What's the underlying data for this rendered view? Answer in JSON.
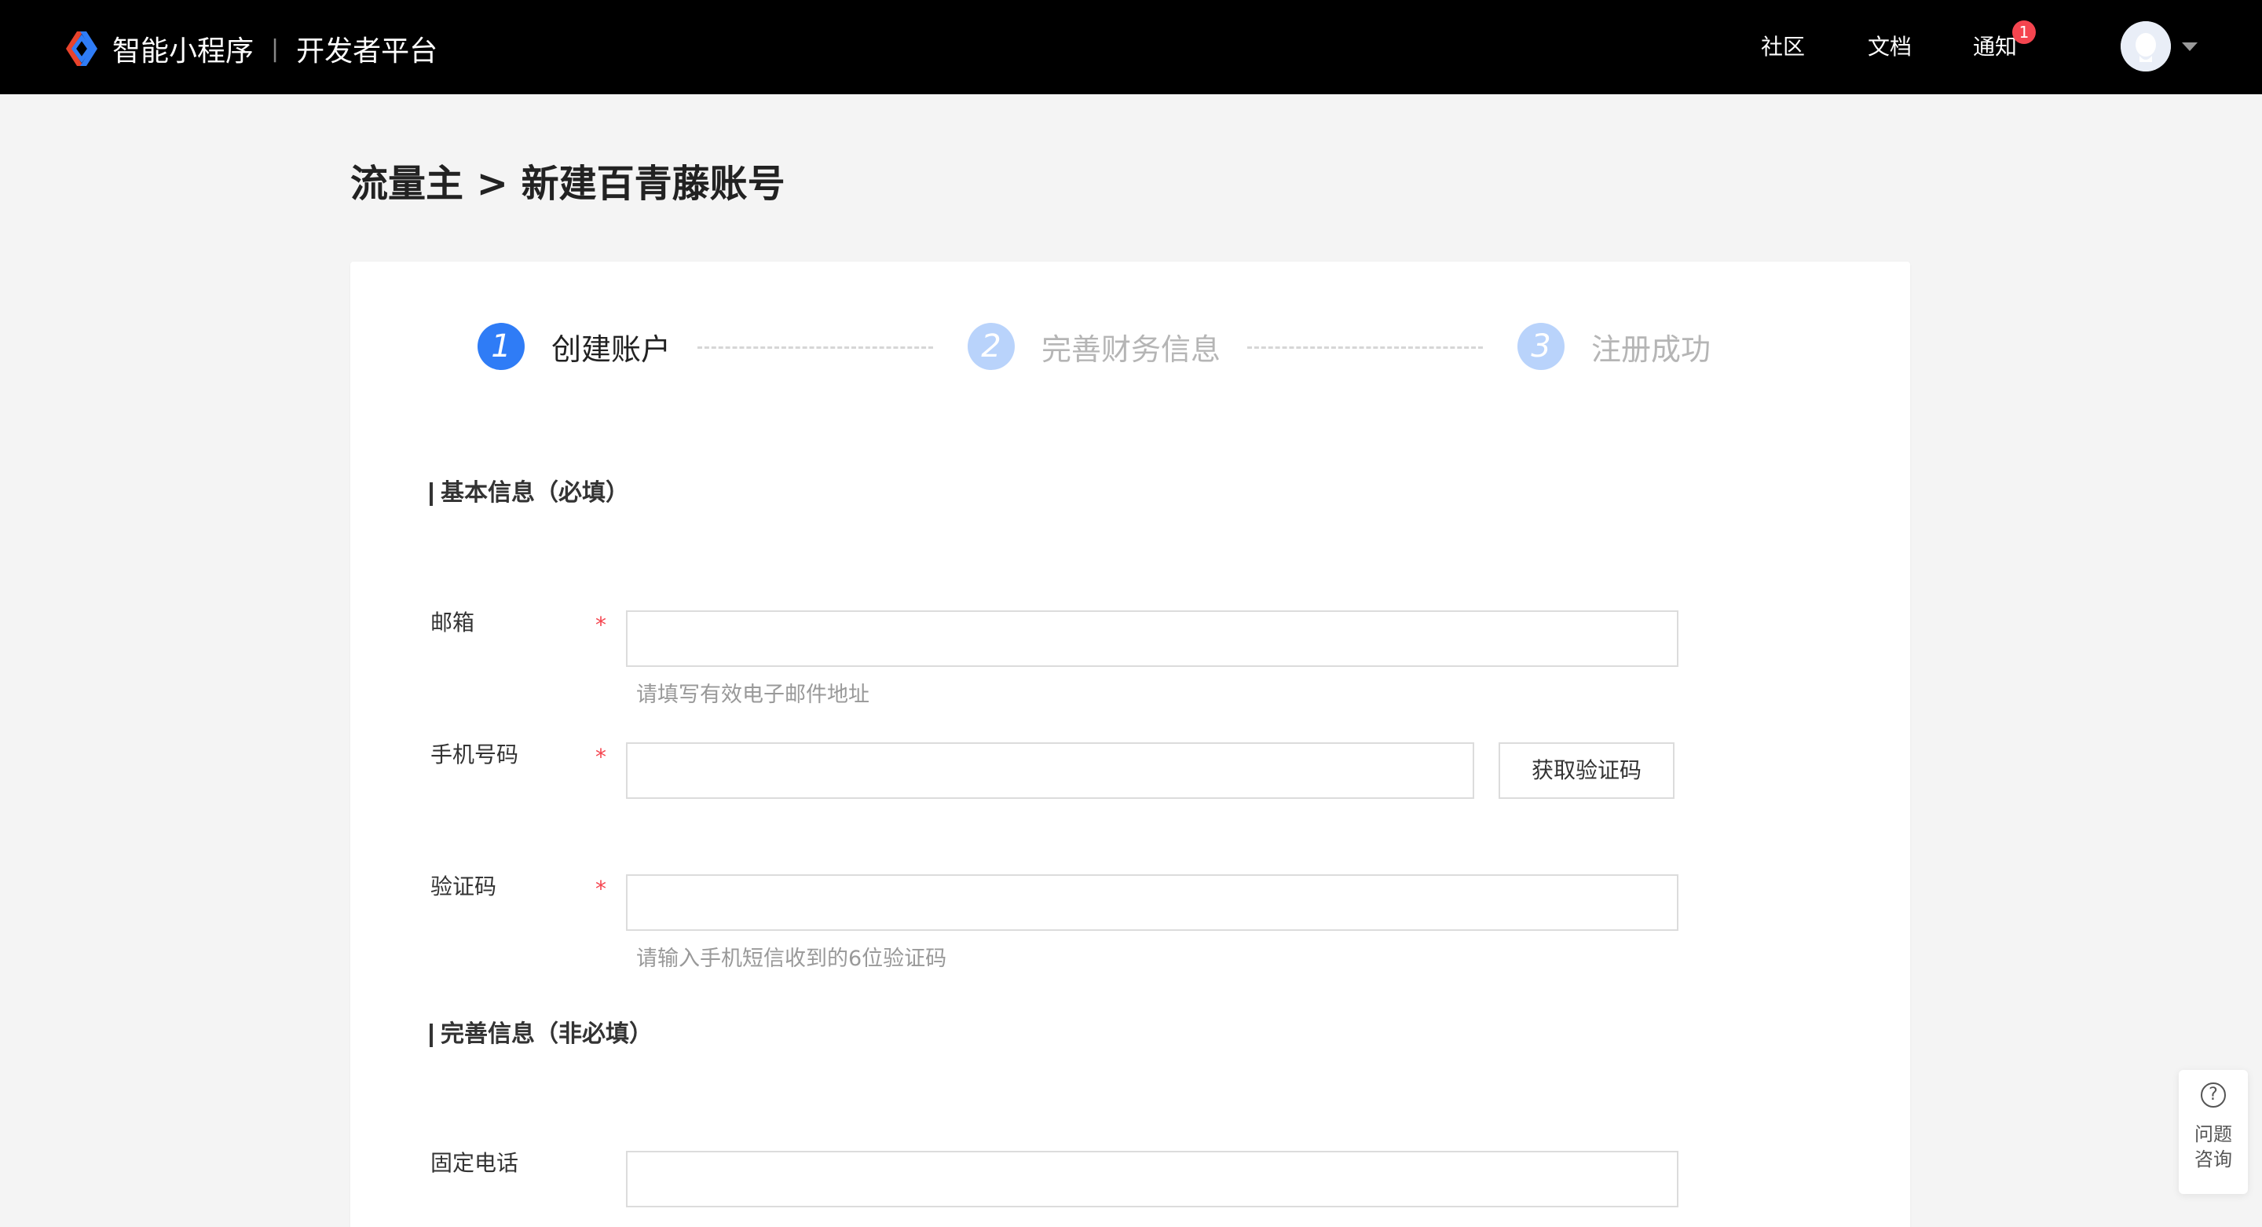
{
  "header": {
    "brand_name": "智能小程序",
    "brand_separator": "|",
    "brand_platform": "开发者平台",
    "nav": {
      "community": "社区",
      "docs": "文档",
      "notify": "通知"
    },
    "notify_badge_count": "1",
    "logo_colors": {
      "left": "#e8432c",
      "right": "#2f7cf6"
    },
    "avatar_icon": "user-avatar-icon",
    "caret_icon": "caret-down-icon"
  },
  "page": {
    "title": "流量主 > 新建百青藤账号"
  },
  "steps": [
    {
      "number": "1",
      "label": "创建账户",
      "state": "active"
    },
    {
      "number": "2",
      "label": "完善财务信息",
      "state": "inactive"
    },
    {
      "number": "3",
      "label": "注册成功",
      "state": "inactive"
    }
  ],
  "form": {
    "basic_section_title": "基本信息（必填）",
    "extra_section_title": "完善信息（非必填）",
    "required_mark": "*",
    "email": {
      "label": "邮箱",
      "value": "",
      "hint": "请填写有效电子邮件地址"
    },
    "phone": {
      "label": "手机号码",
      "value": "",
      "get_code_button": "获取验证码"
    },
    "code": {
      "label": "验证码",
      "value": "",
      "hint": "请输入手机短信收到的6位验证码"
    },
    "landline": {
      "label": "固定电话",
      "value": ""
    }
  },
  "help": {
    "icon": "question-circle-icon",
    "label": "问题\n咨询"
  },
  "colors": {
    "accent": "#2f7cf6",
    "accent_light": "#b9d3fb",
    "required": "#f5454f",
    "topbar": "#000000",
    "background": "#f4f4f4"
  }
}
